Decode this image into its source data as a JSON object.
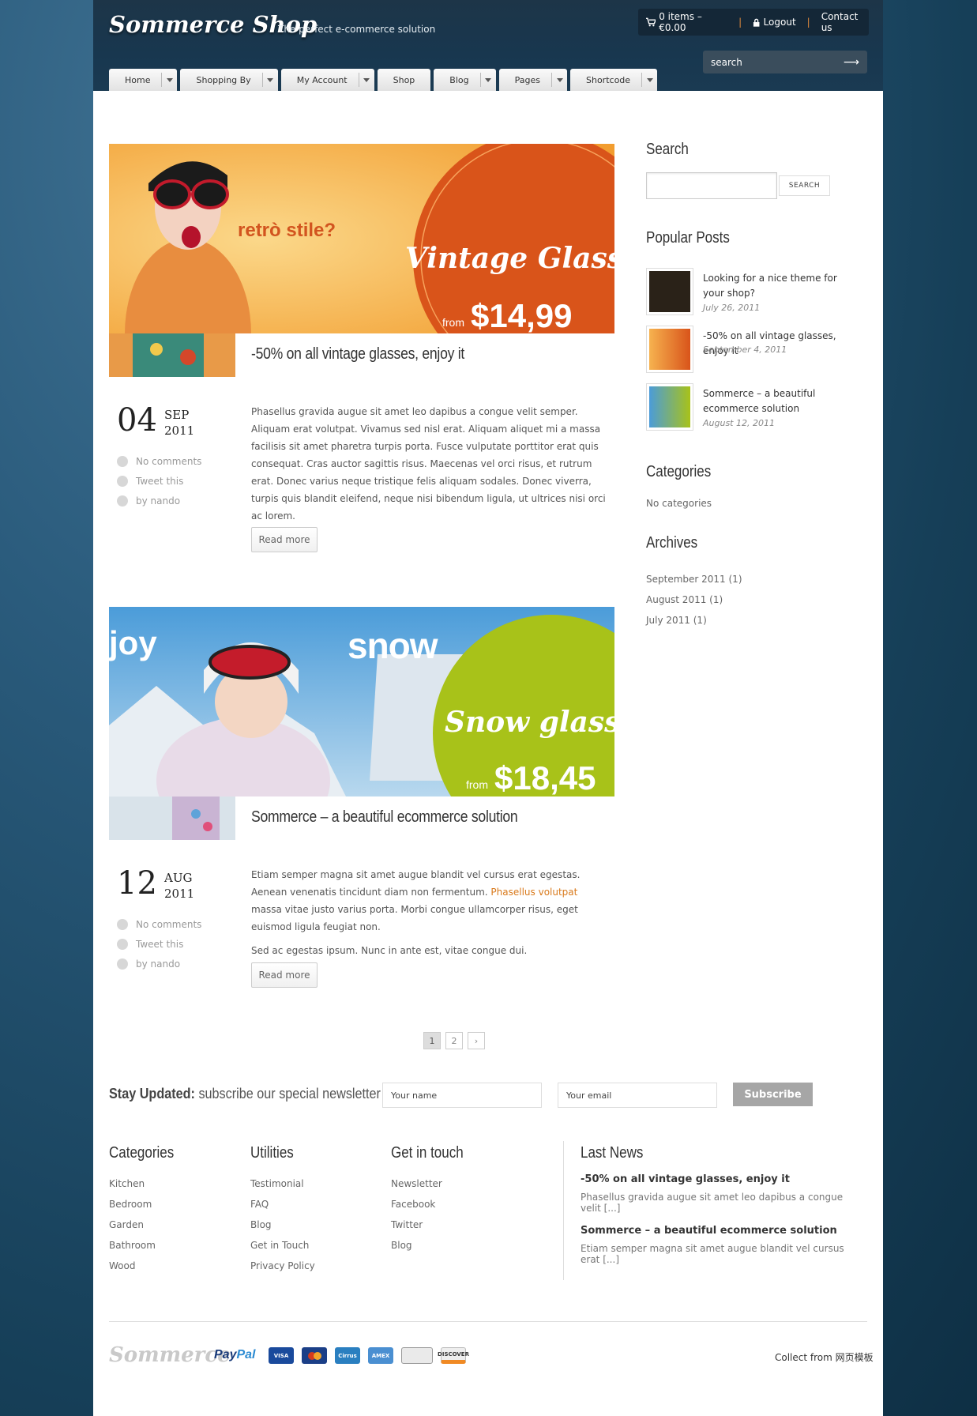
{
  "header": {
    "logo": "Sommerce Shop",
    "tagline": "The perfect e-commerce solution",
    "cart": "0 items – €0.00",
    "logout": "Logout",
    "contact": "Contact us",
    "search_placeholder": "search"
  },
  "nav": [
    "Home",
    "Shopping By",
    "My Account",
    "Shop",
    "Blog",
    "Pages",
    "Shortcode"
  ],
  "posts": [
    {
      "banner_tagline": "retrò stile?",
      "banner_product": "Vintage Glasses",
      "banner_from": "from",
      "banner_price": "$14,99",
      "title": "-50% on all vintage glasses, enjoy it",
      "day": "04",
      "month": "SEP",
      "year": "2011",
      "comments": "No comments",
      "tweet": "Tweet this",
      "author": "by nando",
      "body": [
        "Phasellus gravida augue sit amet leo dapibus a congue velit semper. Aliquam erat volutpat. Vivamus sed nisl erat. Aliquam aliquet mi a massa facilisis sit amet pharetra turpis porta. Fusce vulputate porttitor erat quis consequat. Cras auctor sagittis risus. Maecenas vel orci risus, et rutrum erat. Donec varius neque tristique felis aliquam sodales. Donec viverra, turpis quis blandit eleifend, neque nisi bibendum ligula, ut ultrices nisi orci ac lorem."
      ],
      "read_more": "Read more"
    },
    {
      "banner_tagline": "joy",
      "banner_word": "snow",
      "banner_product": "Snow glasses",
      "banner_from": "from",
      "banner_price": "$18,45",
      "title": "Sommerce – a beautiful ecommerce solution",
      "day": "12",
      "month": "AUG",
      "year": "2011",
      "comments": "No comments",
      "tweet": "Tweet this",
      "author": "by nando",
      "body_1a": "Etiam semper magna sit amet augue blandit vel cursus erat egestas. Aenean venenatis tincidunt diam non fermentum. ",
      "body_1link": "Phasellus volutpat",
      "body_1b": " massa vitae justo varius porta. Morbi congue ullamcorper risus, eget euismod ligula feugiat non.",
      "body_2": "Sed ac egestas ipsum. Nunc in ante est, vitae congue dui.",
      "read_more": "Read more"
    }
  ],
  "pagination": {
    "pages": [
      "1",
      "2"
    ],
    "next": "›"
  },
  "sidebar": {
    "search_title": "Search",
    "search_button": "SEARCH",
    "popular_title": "Popular Posts",
    "popular": [
      {
        "title": "Looking for a nice theme for your shop?",
        "date": "July 26, 2011"
      },
      {
        "title": "-50% on all vintage glasses, enjoy it",
        "date": "September 4, 2011"
      },
      {
        "title": "Sommerce – a beautiful ecommerce solution",
        "date": "August 12, 2011"
      }
    ],
    "categories_title": "Categories",
    "categories_empty": "No categories",
    "archives_title": "Archives",
    "archives": [
      "September 2011 (1)",
      "August 2011 (1)",
      "July 2011 (1)"
    ]
  },
  "newsletter": {
    "bold": "Stay Updated:",
    "text": "subscribe our special newsletter",
    "name_placeholder": "Your name",
    "email_placeholder": "Your email",
    "button": "Subscribe"
  },
  "footer": {
    "categories_title": "Categories",
    "categories": [
      "Kitchen",
      "Bedroom",
      "Garden",
      "Bathroom",
      "Wood"
    ],
    "utilities_title": "Utilities",
    "utilities": [
      "Testimonial",
      "FAQ",
      "Blog",
      "Get in Touch",
      "Privacy Policy"
    ],
    "touch_title": "Get in touch",
    "touch": [
      "Newsletter",
      "Facebook",
      "Twitter",
      "Blog"
    ],
    "news_title": "Last News",
    "news": [
      {
        "title": "-50% on all vintage glasses, enjoy it",
        "excerpt": "Phasellus gravida augue sit amet leo dapibus a congue velit [...]"
      },
      {
        "title": "Sommerce – a beautiful ecommerce solution",
        "excerpt": "Etiam semper magna sit amet augue blandit vel cursus erat [...]"
      }
    ],
    "logo": "Sommerce",
    "paypal_a": "Pay",
    "paypal_b": "Pal",
    "cards": [
      {
        "name": "VISA",
        "color": "#1a4a9c"
      },
      {
        "name": "MC",
        "color": "#d33b1f"
      },
      {
        "name": "Cirrus",
        "color": "#2a7fc0"
      },
      {
        "name": "AMEX",
        "color": "#4a8fd1"
      },
      {
        "name": "",
        "color": "#e8e8e8"
      },
      {
        "name": "DISCOVER",
        "color": "#eeeeee"
      }
    ],
    "collect": "Collect from 网页模板"
  }
}
